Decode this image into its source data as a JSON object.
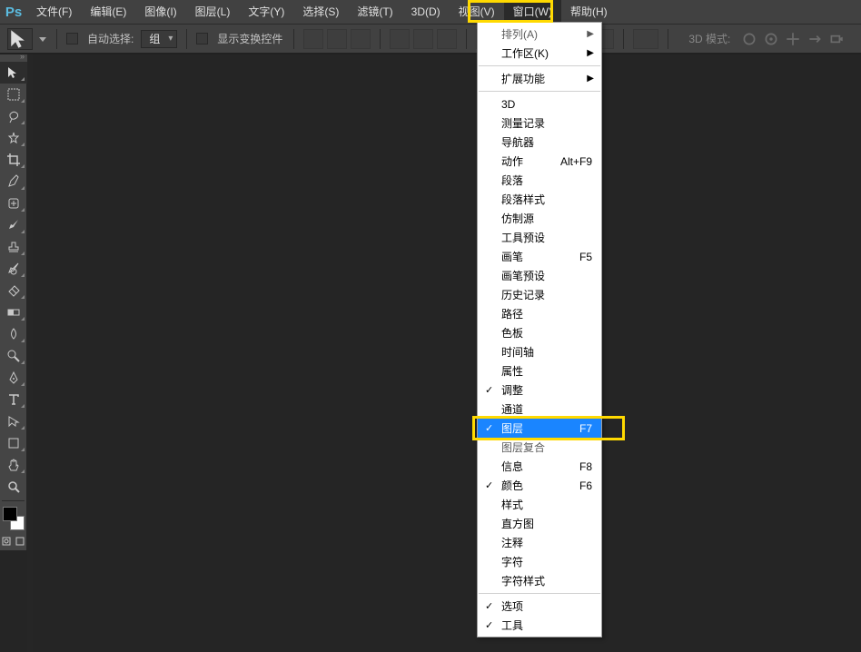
{
  "app": {
    "logo": "Ps"
  },
  "menubar": [
    "文件(F)",
    "编辑(E)",
    "图像(I)",
    "图层(L)",
    "文字(Y)",
    "选择(S)",
    "滤镜(T)",
    "3D(D)",
    "视图(V)",
    "窗口(W)",
    "帮助(H)"
  ],
  "active_menu_index": 9,
  "optionsbar": {
    "auto_select": "自动选择:",
    "group": "组",
    "show_controls": "显示变换控件",
    "mode3d": "3D 模式:"
  },
  "dropdown": {
    "items": [
      {
        "label": "排列(A)",
        "type": "submenu",
        "dim": true
      },
      {
        "label": "工作区(K)",
        "type": "submenu"
      },
      {
        "type": "sep"
      },
      {
        "label": "扩展功能",
        "type": "submenu"
      },
      {
        "type": "sep"
      },
      {
        "label": "3D"
      },
      {
        "label": "测量记录"
      },
      {
        "label": "导航器"
      },
      {
        "label": "动作",
        "shortcut": "Alt+F9"
      },
      {
        "label": "段落"
      },
      {
        "label": "段落样式"
      },
      {
        "label": "仿制源"
      },
      {
        "label": "工具预设"
      },
      {
        "label": "画笔",
        "shortcut": "F5"
      },
      {
        "label": "画笔预设"
      },
      {
        "label": "历史记录"
      },
      {
        "label": "路径"
      },
      {
        "label": "色板"
      },
      {
        "label": "时间轴"
      },
      {
        "label": "属性"
      },
      {
        "label": "调整",
        "checked": true
      },
      {
        "label": "通道"
      },
      {
        "label": "图层",
        "shortcut": "F7",
        "checked": true,
        "highlight": true
      },
      {
        "label": "图层复合",
        "dim": true
      },
      {
        "label": "信息",
        "shortcut": "F8"
      },
      {
        "label": "颜色",
        "shortcut": "F6",
        "checked": true
      },
      {
        "label": "样式"
      },
      {
        "label": "直方图"
      },
      {
        "label": "注释"
      },
      {
        "label": "字符"
      },
      {
        "label": "字符样式"
      },
      {
        "type": "sep"
      },
      {
        "label": "选项",
        "checked": true
      },
      {
        "label": "工具",
        "checked": true
      }
    ]
  },
  "tools": [
    "move",
    "marquee",
    "lasso",
    "magic-wand",
    "crop",
    "eyedropper",
    "spot-heal",
    "brush",
    "clone-stamp",
    "history-brush",
    "eraser",
    "gradient",
    "blur",
    "dodge",
    "pen",
    "type",
    "path-select",
    "rectangle-shape",
    "hand",
    "zoom"
  ]
}
